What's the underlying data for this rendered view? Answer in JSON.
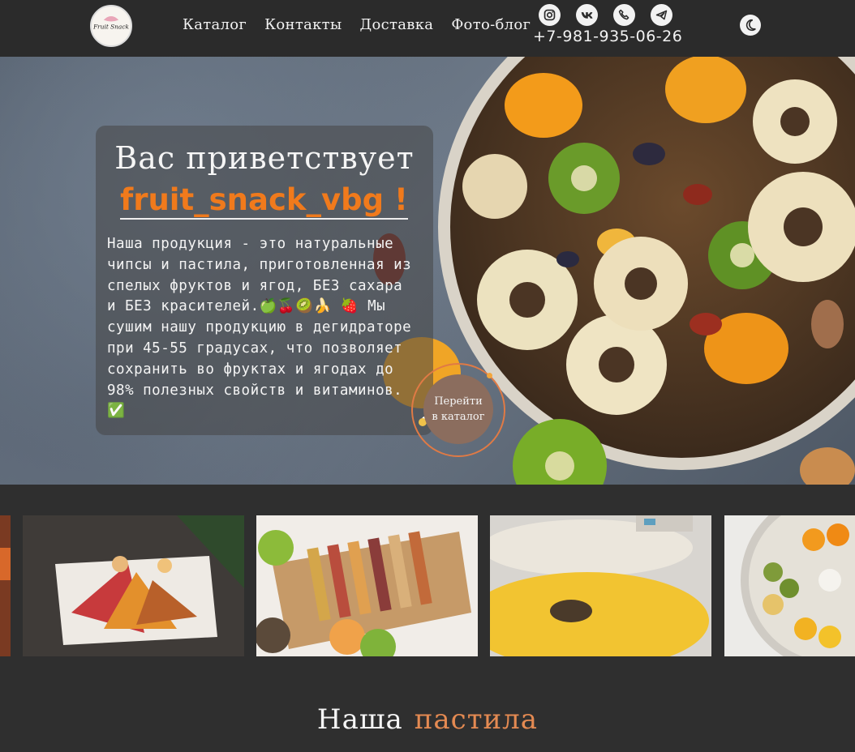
{
  "header": {
    "logo_text": "Fruit Snack",
    "nav": [
      "Каталог",
      "Контакты",
      "Доставка",
      "Фото-блог"
    ],
    "socials": [
      "instagram-icon",
      "vk-icon",
      "phone-icon",
      "telegram-icon"
    ],
    "phone": "+7-981-935-06-26",
    "theme_toggle": "moon-icon"
  },
  "hero": {
    "title": "Вас приветствует",
    "brand": "fruit_snack_vbg !",
    "text": "Наша продукция - это натуральные чипсы и пастила, приготовленная из спелых фруктов и ягод, БЕЗ сахара и БЕЗ красителей.🍏🍒🥝🍌 🍓 Мы сушим нашу продукцию в дегидраторе при 45-55 градусах, что позволяет сохранить во фруктах и ягодах до 98% полезных свойств и витаминов. ✅",
    "cta_line1": "Перейти",
    "cta_line2": "в каталог"
  },
  "gallery": [
    "pastila-platter",
    "pastila-rolls-box",
    "dehydrator-pineapple",
    "dehydrator-citrus"
  ],
  "section": {
    "word1": "Наша",
    "word2": "пастила"
  },
  "colors": {
    "accent": "#f07a1c",
    "dark": "#2f2f2f",
    "section_accent": "#e48a52"
  }
}
